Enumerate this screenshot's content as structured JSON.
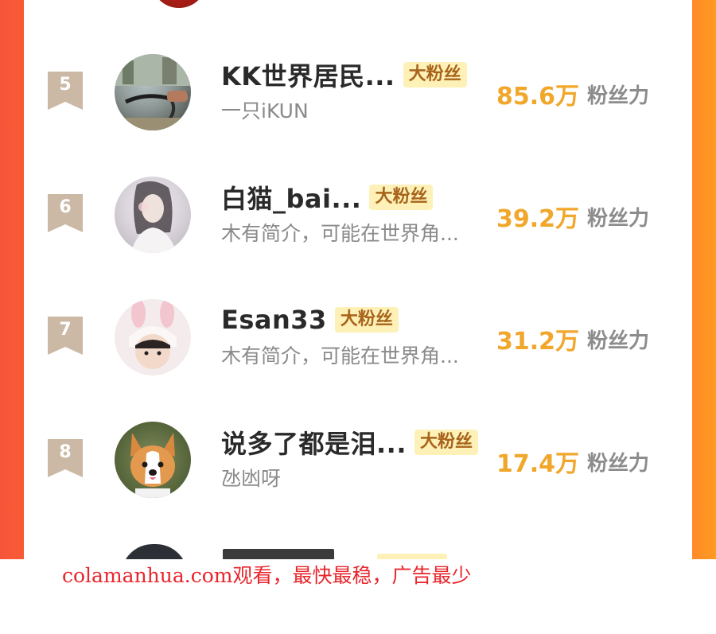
{
  "colors": {
    "score": "#f0a72b",
    "tag_bg": "#fdf1b8",
    "tag_text": "#a8641b",
    "rank_badge": "#cbb9a6",
    "watermark": "#e8262d"
  },
  "rows": [
    {
      "rank": "5",
      "name": "KK世界居民...",
      "tag": "大粉丝",
      "subtitle": "一只iKUN",
      "score": "85.6万",
      "score_label": "粉丝力"
    },
    {
      "rank": "6",
      "name": "白猫_bai...",
      "tag": "大粉丝",
      "subtitle": "木有简介，可能在世界角...",
      "score": "39.2万",
      "score_label": "粉丝力"
    },
    {
      "rank": "7",
      "name": "Esan33",
      "tag": "大粉丝",
      "subtitle": "木有简介，可能在世界角...",
      "score": "31.2万",
      "score_label": "粉丝力"
    },
    {
      "rank": "8",
      "name": "说多了都是泪...",
      "tag": "大粉丝",
      "subtitle": "氹凼呀",
      "score": "17.4万",
      "score_label": "粉丝力"
    }
  ],
  "watermark": "colamanhua.com观看，最快最稳，广告最少"
}
